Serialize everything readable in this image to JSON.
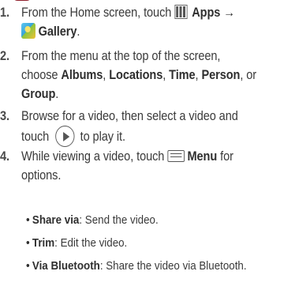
{
  "steps": [
    {
      "number": "1.",
      "lines": {
        "line1_prefix": "From the Home screen, touch",
        "line1_apps": "Apps",
        "line1_arrow": "→",
        "line2_gallery": "Gallery",
        "line2_period": "."
      }
    },
    {
      "number": "2.",
      "lines": {
        "line1": "From the menu at the top of the screen,",
        "line2_prefix": "choose",
        "albums": "Albums",
        "comma1": ",",
        "locations": "Locations",
        "comma2": ",",
        "time": "Time",
        "comma3": ",",
        "person": "Person",
        "or": ", or",
        "group": "Group",
        "period": "."
      }
    },
    {
      "number": "3.",
      "lines": {
        "line1": "Browse for a video, then select a video and",
        "line2_prefix": "touch",
        "line2_suffix": "to play it."
      }
    },
    {
      "number": "4.",
      "lines": {
        "line1_prefix": "While viewing a video, touch",
        "menu": "Menu",
        "line1_suffix": "for",
        "line2": "options."
      }
    }
  ],
  "bullets": [
    {
      "label": "Share via",
      "text": ": Send the video."
    },
    {
      "label": "Trim",
      "text": ": Edit the video."
    },
    {
      "label": "Via Bluetooth",
      "text": ": Share the video via Bluetooth."
    }
  ],
  "icons": {
    "apps": "apps-grid-icon",
    "gallery": "gallery-icon",
    "play": "play-icon",
    "menu": "menu-icon"
  },
  "colors": {
    "text": "#3a3a3a",
    "bold": "#2f2f2f",
    "heading_fragment": "#8f1f2b"
  }
}
